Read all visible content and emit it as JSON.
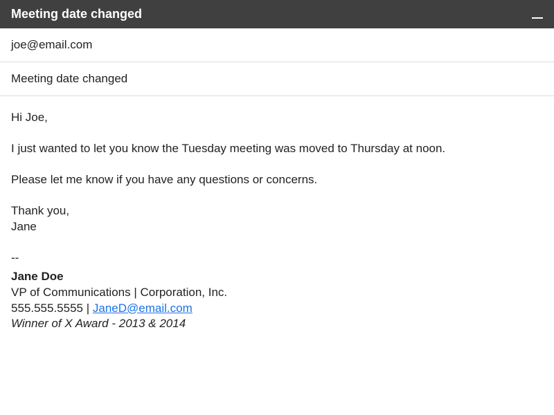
{
  "titlebar": {
    "title": "Meeting date changed"
  },
  "fields": {
    "to": "joe@email.com",
    "subject": "Meeting date changed"
  },
  "body": {
    "greeting": "Hi Joe,",
    "line1": "I just wanted to let you know the Tuesday meeting was moved to Thursday at noon.",
    "line2": "Please let me know if you have any questions or concerns.",
    "closing_thanks": "Thank you,",
    "closing_name": "Jane"
  },
  "signature": {
    "separator": "--",
    "name": "Jane Doe",
    "title_prefix": "VP of Communications | Corporation, Inc.",
    "phone": "555.555.5555",
    "pipe": " | ",
    "email": "JaneD@email.com",
    "award": "Winner of X Award - 2013 & 2014"
  }
}
